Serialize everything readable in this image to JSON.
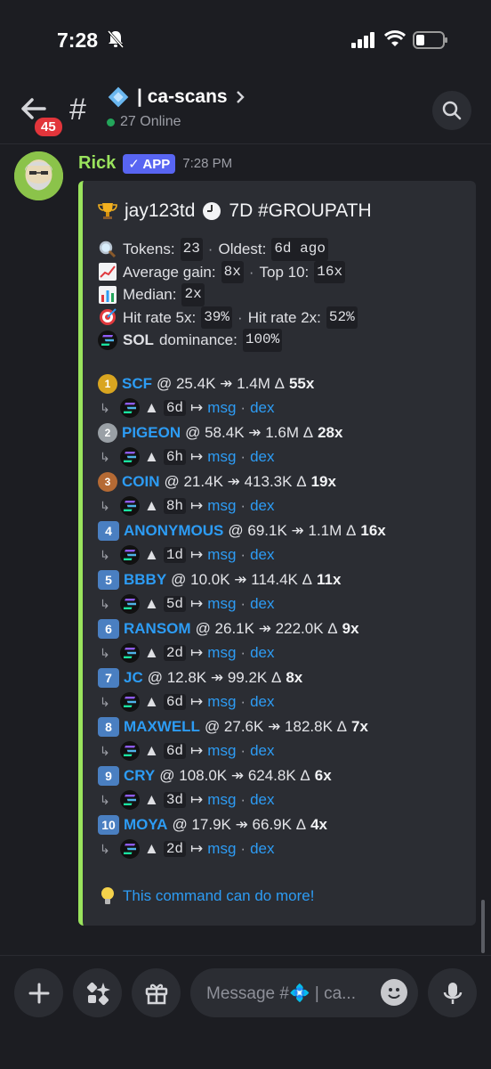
{
  "status_bar": {
    "time": "7:28"
  },
  "header": {
    "back_badge": "45",
    "channel_name": "| ca-scans",
    "online": "27 Online"
  },
  "message": {
    "author": "Rick",
    "tag": "✓ APP",
    "time": "7:28 PM",
    "embed": {
      "title_user": "jay123td",
      "title_suffix": "7D #GROUPATH",
      "tokens_label": "Tokens:",
      "tokens_value": "23",
      "oldest_label": "Oldest:",
      "oldest_value": "6d ago",
      "avg_label": "Average gain:",
      "avg_value": "8x",
      "top10_label": "Top 10:",
      "top10_value": "16x",
      "median_label": "Median:",
      "median_value": "2x",
      "hit5_label": "Hit rate 5x:",
      "hit5_value": "39%",
      "hit2_label": "Hit rate 2x:",
      "hit2_value": "52%",
      "sol_label": "SOL",
      "dominance_label": "dominance:",
      "dominance_value": "100%",
      "ranks": [
        {
          "rank": "1",
          "token": "SCF",
          "from": "@ 25.4K ↠ 1.4M Δ",
          "mult": "55x",
          "age": "6d"
        },
        {
          "rank": "2",
          "token": "PIGEON",
          "from": "@ 58.4K ↠ 1.6M Δ",
          "mult": "28x",
          "age": "6h"
        },
        {
          "rank": "3",
          "token": "COIN",
          "from": "@ 21.4K ↠ 413.3K Δ",
          "mult": "19x",
          "age": "8h"
        },
        {
          "rank": "4",
          "token": "ANONYMOUS",
          "from": "@ 69.1K ↠ 1.1M Δ",
          "mult": "16x",
          "age": "1d"
        },
        {
          "rank": "5",
          "token": "BBBY",
          "from": "@ 10.0K ↠ 114.4K Δ",
          "mult": "11x",
          "age": "5d"
        },
        {
          "rank": "6",
          "token": "RANSOM",
          "from": "@ 26.1K ↠ 222.0K Δ",
          "mult": "9x",
          "age": "2d"
        },
        {
          "rank": "7",
          "token": "JC",
          "from": "@ 12.8K ↠ 99.2K Δ",
          "mult": "8x",
          "age": "6d"
        },
        {
          "rank": "8",
          "token": "MAXWELL",
          "from": "@ 27.6K ↠ 182.8K Δ",
          "mult": "7x",
          "age": "6d"
        },
        {
          "rank": "9",
          "token": "CRY",
          "from": "@ 108.0K ↠ 624.8K Δ",
          "mult": "6x",
          "age": "3d"
        },
        {
          "rank": "10",
          "token": "MOYA",
          "from": "@ 17.9K ↠ 66.9K Δ",
          "mult": "4x",
          "age": "2d"
        }
      ],
      "up_arrow": "▲",
      "arrow": "↦",
      "msg_link": "msg",
      "dot_sep": "·",
      "dex_link": "dex",
      "tip": "This command can do more!"
    }
  },
  "composer": {
    "placeholder": "Message #💠 | ca..."
  },
  "colors": {
    "accent": "#9ae35d",
    "link": "#2d9cf4",
    "app_tag": "#5865f2",
    "badge": "#e2353b"
  }
}
